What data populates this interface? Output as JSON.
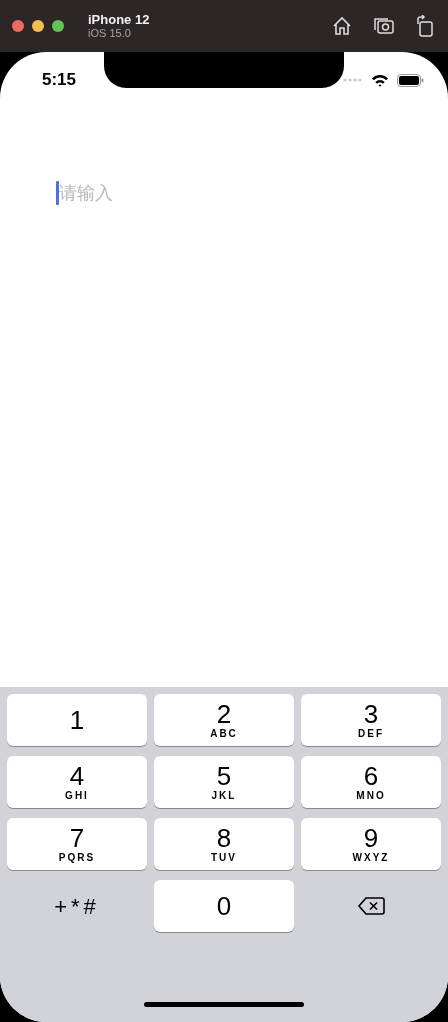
{
  "window": {
    "title": "iPhone 12",
    "subtitle": "iOS 15.0"
  },
  "status_bar": {
    "time": "5:15"
  },
  "input": {
    "placeholder": "请输入",
    "focused": true
  },
  "keypad": [
    {
      "kind": "digit",
      "digit": "1"
    },
    {
      "kind": "digit",
      "digit": "2",
      "letters": "ABC"
    },
    {
      "kind": "digit",
      "digit": "3",
      "letters": "DEF"
    },
    {
      "kind": "digit",
      "digit": "4",
      "letters": "GHI"
    },
    {
      "kind": "digit",
      "digit": "5",
      "letters": "JKL"
    },
    {
      "kind": "digit",
      "digit": "6",
      "letters": "MNO"
    },
    {
      "kind": "digit",
      "digit": "7",
      "letters": "PQRS"
    },
    {
      "kind": "digit",
      "digit": "8",
      "letters": "TUV"
    },
    {
      "kind": "digit",
      "digit": "9",
      "letters": "WXYZ"
    },
    {
      "kind": "symbols",
      "label": "+*#"
    },
    {
      "kind": "digit",
      "digit": "0"
    },
    {
      "kind": "delete"
    }
  ]
}
